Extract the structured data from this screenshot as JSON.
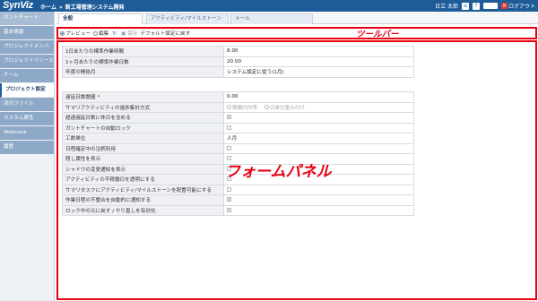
{
  "header": {
    "logo": "SynViz",
    "crumbs": [
      "ホーム",
      "新工場管理システム開発"
    ],
    "crumb_sep": "»",
    "user": "日立 太郎",
    "icons": [
      "home-icon",
      "help-icon",
      "lang-select",
      "close-icon"
    ],
    "lang_select": "",
    "logout_label": "ログアウト"
  },
  "sidebar": {
    "items": [
      {
        "label": "ガントチャート"
      },
      {
        "label": "基本情報"
      },
      {
        "label": "プロジェクトメンバ"
      },
      {
        "label": "プロジェクトリソース"
      },
      {
        "label": "チーム"
      },
      {
        "label": "プロジェクト設定"
      },
      {
        "label": "添付ファイル"
      },
      {
        "label": "カスタム属性"
      },
      {
        "label": "Webhook"
      },
      {
        "label": "履歴"
      }
    ],
    "active_index": 5
  },
  "tabs": [
    {
      "label": "全般"
    },
    {
      "label": "アクティビティ/マイルストーン"
    },
    {
      "label": "メール"
    }
  ],
  "toolbar": {
    "preview_label": "プレビュー",
    "edit_label": "編集",
    "save_label": "保存",
    "default_label": "デフォルト設定に戻す",
    "annotation": "ツールバー"
  },
  "form": {
    "annotation": "フォームパネル",
    "group1": [
      {
        "label": "1日あたりの標準作業時間",
        "value": "8.00"
      },
      {
        "label": "1ヶ月あたりの標準作業日数",
        "value": "20.00"
      },
      {
        "label": "年度の開始月",
        "value": "システム設定に従う(1月)"
      }
    ],
    "group2": {
      "threshold": {
        "label": "遅延日数閾値",
        "required_mark": "*",
        "value": "0.00"
      },
      "summary_method": {
        "label": "サマリアクティビティの進捗集計方式",
        "options": [
          "期間内均等",
          "日単位重み付け"
        ]
      },
      "checkbox_rows": [
        {
          "label": "経過遅延日数に休日を含める",
          "checked": true
        },
        {
          "label": "ガントチャートの自動ロック",
          "checked": false
        }
      ],
      "effort_unit": {
        "label": "工数単位",
        "value": "人月"
      },
      "checkbox_rows2": [
        {
          "label": "日程確定中の注釈利用",
          "checked": false
        },
        {
          "label": "隠し属性を表示",
          "checked": false
        },
        {
          "label": "シャドウの変更通知を表示",
          "checked": false
        },
        {
          "label": "アクティビティの不稼働日を透明にする",
          "checked": false
        },
        {
          "label": "サマリタスクにアクティビティ/マイルストーンを配置可能にする",
          "checked": false
        },
        {
          "label": "作業日程の不整合を自動的に通知する",
          "checked": true
        },
        {
          "label": "ロック中の元に戻す / やり直しを有効化",
          "checked": true
        }
      ]
    }
  },
  "colors": {
    "header_bg": "#1e5c99",
    "sidebar_item_bg": "#8ea9c8",
    "annotation_red": "#e8000f"
  }
}
